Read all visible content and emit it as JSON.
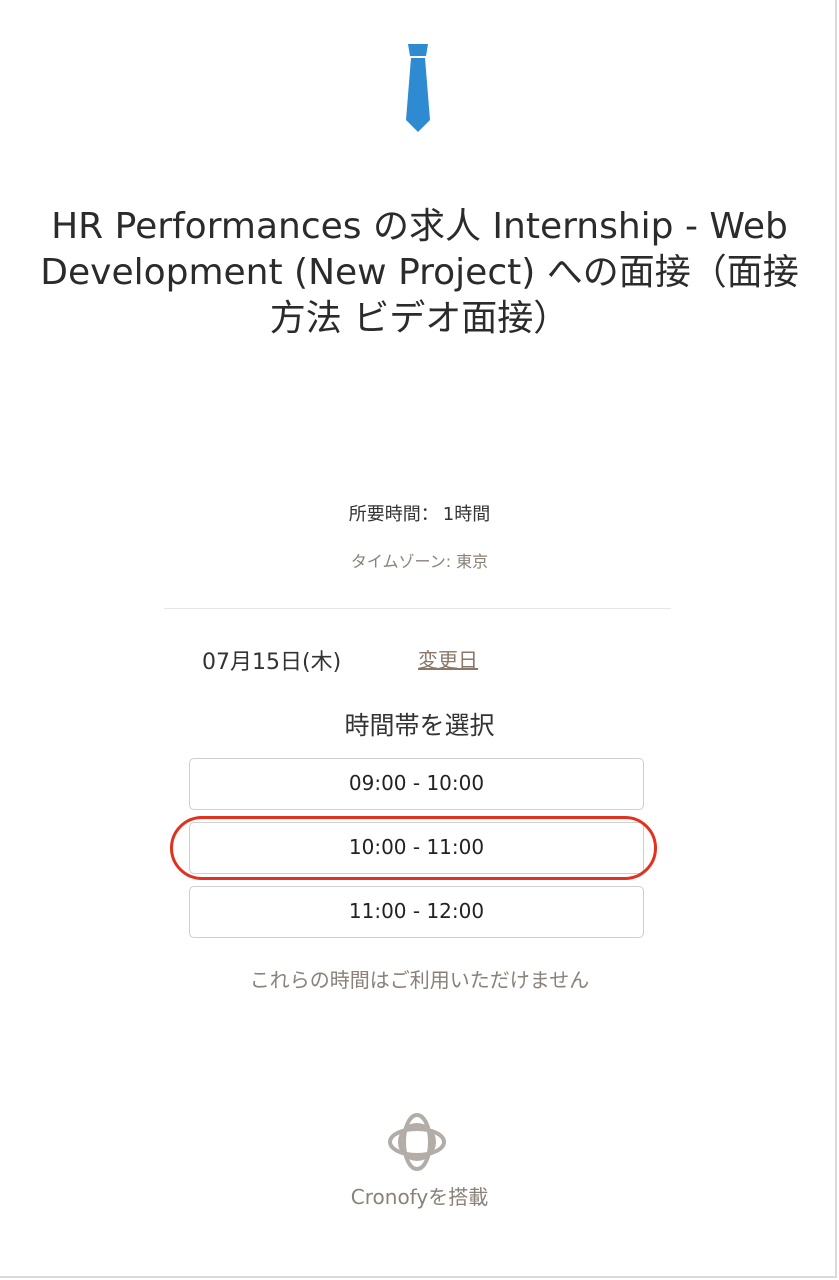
{
  "title": "HR Performances の求人 Internship - Web Development (New Project) への面接（面接方法 ビデオ面接）",
  "duration": {
    "label": "所要時間：",
    "value": "1時間"
  },
  "timezone": "タイムゾーン: 東京",
  "date": {
    "value": "07月15日(木)",
    "change_label": "変更日"
  },
  "select_label": "時間帯を選択",
  "slots": [
    {
      "label": "09:00 - 10:00"
    },
    {
      "label": "10:00 - 11:00",
      "highlighted": true
    },
    {
      "label": "11:00 - 12:00"
    }
  ],
  "unavailable_text": "これらの時間はご利用いただけません",
  "footer": {
    "powered_by": "Cronofyを搭載",
    "logo_icon": "cronofy-logo-icon"
  },
  "header": {
    "logo_icon": "tie-icon"
  },
  "colors": {
    "tie": "#2e8bd1",
    "highlight": "#e4311f",
    "muted_text": "#8a8178",
    "border": "#cfcfcf"
  }
}
